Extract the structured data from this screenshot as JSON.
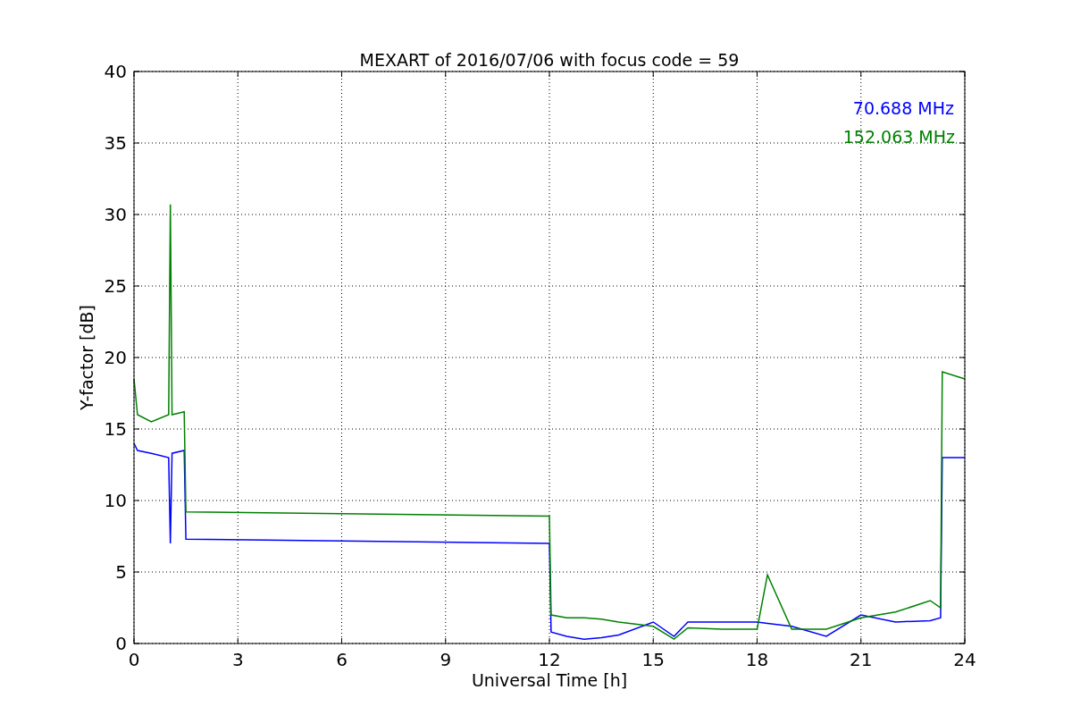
{
  "chart_data": {
    "type": "line",
    "title": "MEXART of 2016/07/06 with focus code = 59",
    "xlabel": "Universal Time [h]",
    "ylabel": "Y-factor [dB]",
    "x": [
      0,
      0.1,
      0.5,
      1.0,
      1.05,
      1.1,
      1.45,
      1.5,
      12.0,
      12.05,
      12.5,
      13,
      13.5,
      14,
      15,
      15.6,
      16,
      17,
      18,
      18.3,
      19,
      20,
      21,
      22,
      23,
      23.3,
      23.35,
      24
    ],
    "series": [
      {
        "name": "70.688 MHz",
        "color": "#0000ff",
        "values": [
          14,
          13.5,
          13.3,
          13,
          7,
          13.3,
          13.5,
          7.3,
          7.0,
          0.8,
          0.5,
          0.3,
          0.4,
          0.6,
          1.5,
          0.5,
          1.5,
          1.5,
          1.5,
          1.4,
          1.2,
          0.5,
          2.0,
          1.5,
          1.6,
          1.8,
          13,
          13
        ]
      },
      {
        "name": "152.063 MHz",
        "color": "#008000",
        "values": [
          18.5,
          16,
          15.5,
          16,
          30.7,
          16,
          16.2,
          9.2,
          8.9,
          2,
          1.8,
          1.8,
          1.7,
          1.5,
          1.2,
          0.3,
          1.1,
          1.0,
          1.0,
          4.8,
          1.0,
          1.0,
          1.8,
          2.2,
          3,
          2.5,
          19,
          18.5
        ]
      }
    ],
    "xlim": [
      0,
      24
    ],
    "ylim": [
      0,
      40
    ],
    "xticks": [
      0,
      3,
      6,
      9,
      12,
      15,
      18,
      21,
      24
    ],
    "yticks": [
      0,
      5,
      10,
      15,
      20,
      25,
      30,
      35,
      40
    ],
    "grid": true
  }
}
